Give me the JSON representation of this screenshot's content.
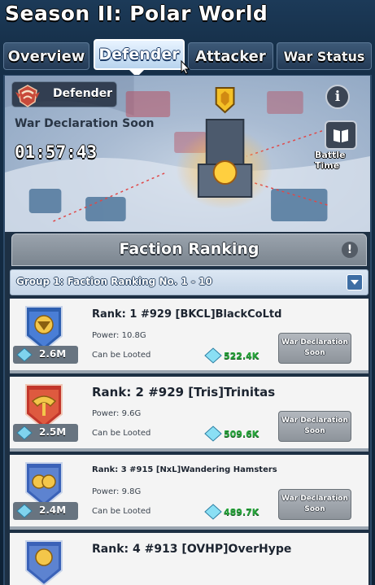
{
  "header": {
    "title": "Season II: Polar World"
  },
  "tabs": [
    {
      "label": "Overview",
      "active": false
    },
    {
      "label": "Defender",
      "active": true
    },
    {
      "label": "Attacker",
      "active": false
    },
    {
      "label": "War Status",
      "active": false
    }
  ],
  "banner": {
    "role_label": "Defender",
    "status": "War Declaration Soon",
    "countdown": "01:57:43",
    "info_icon": "info-icon",
    "battle_time_label": "Battle Time"
  },
  "ranking": {
    "title": "Faction Ranking",
    "group_label": "Group 1: Faction Ranking No. 1 - 10",
    "rows": [
      {
        "rank": "Rank: 1 #929 [BKCL]BlackCoLtd",
        "power": "Power: 10.8G",
        "lootable": "Can be Looted",
        "loot_total": "2.6M",
        "gem_value": "522.4K",
        "war_btn_line1": "War Declaration",
        "war_btn_line2": "Soon",
        "emblem_color": "#2e5fb0"
      },
      {
        "rank": "Rank: 2 #929 [Tris]Trinitas",
        "power": "Power: 9.6G",
        "lootable": "Can be Looted",
        "loot_total": "2.5M",
        "gem_value": "509.6K",
        "war_btn_line1": "War Declaration",
        "war_btn_line2": "Soon",
        "emblem_color": "#c2362b"
      },
      {
        "rank": "Rank: 3 #915 [NxL]Wandering Hamsters",
        "power": "Power: 9.8G",
        "lootable": "Can be Looted",
        "loot_total": "2.4M",
        "gem_value": "489.7K",
        "war_btn_line1": "War Declaration",
        "war_btn_line2": "Soon",
        "emblem_color": "#3a62b8"
      },
      {
        "rank": "Rank: 4 #913 [OVHP]OverHype",
        "power": "",
        "lootable": "",
        "loot_total": "",
        "gem_value": "",
        "war_btn_line1": "",
        "war_btn_line2": "",
        "emblem_color": "#3a62b8"
      }
    ]
  },
  "colors": {
    "accent_green": "#28a63c",
    "panel_bg": "#f4f4f4",
    "frame_dark": "#0e2236"
  }
}
